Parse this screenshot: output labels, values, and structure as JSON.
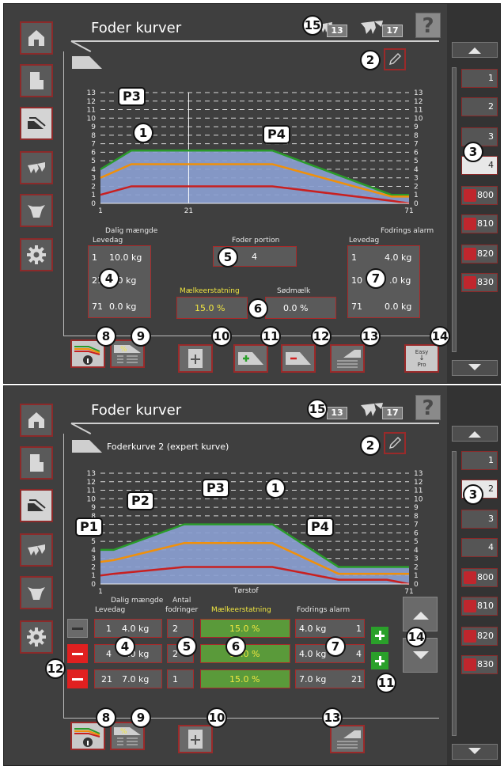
{
  "panel1": {
    "title": "Foder kurver",
    "cow_count_1": "13",
    "cow_count_2": "17",
    "help_label": "?",
    "curve_name": "",
    "chart_data": {
      "type": "area",
      "x_ticks": [
        "1",
        "21",
        "71"
      ],
      "y_ticks": [
        "0",
        "1",
        "2",
        "3",
        "4",
        "5",
        "6",
        "7",
        "8",
        "9",
        "10",
        "11",
        "12",
        "13"
      ],
      "x": [
        1,
        8,
        21,
        40,
        67,
        71
      ],
      "series": [
        {
          "color": "#2a9a2a",
          "values": [
            4,
            6.2,
            6.2,
            6.2,
            1.0,
            1.0
          ]
        },
        {
          "color": "#f0900a",
          "values": [
            3,
            4.6,
            4.6,
            4.6,
            0.8,
            0.8
          ]
        },
        {
          "color": "#c82020",
          "values": [
            1,
            2.0,
            2.0,
            2.0,
            0.3,
            0.0
          ]
        }
      ],
      "fill_color": "#8a9ed0",
      "ylim": [
        0,
        13
      ]
    },
    "labels": {
      "dalig_maengde": "Dalig mængde",
      "levedag": "Levedag",
      "foder_portion": "Foder portion",
      "fodrings_alarm": "Fodrings alarm",
      "levedag2": "Levedag",
      "maelkeerstatning": "Mælkeerstatning",
      "sodmaelk": "Sødmælk"
    },
    "daily_rows": [
      {
        "day": "1",
        "amount": "10.0 kg"
      },
      {
        "day": "21",
        "amount": "0.0 kg"
      },
      {
        "day": "71",
        "amount": "0.0 kg"
      }
    ],
    "portion_value": "4",
    "alarm_rows": [
      {
        "day": "1",
        "amount": "4.0 kg"
      },
      {
        "day": "10",
        "amount": ".0 kg"
      },
      {
        "day": "71",
        "amount": "0.0 kg"
      }
    ],
    "maelk_value": "15.0 %",
    "sod_value": "0.0 %",
    "easy_label": "Easy",
    "pro_label": "Pro"
  },
  "panel2": {
    "title": "Foder kurver",
    "cow_count_1": "13",
    "cow_count_2": "17",
    "help_label": "?",
    "curve_name": "Foderkurve 2 (expert kurve)",
    "chart_data": {
      "type": "area",
      "x_ticks": [
        "1",
        "71"
      ],
      "y_ticks": [
        "0",
        "1",
        "2",
        "3",
        "4",
        "5",
        "6",
        "7",
        "8",
        "9",
        "10",
        "11",
        "12",
        "13"
      ],
      "x": [
        1,
        4,
        20,
        40,
        55,
        66,
        71
      ],
      "series": [
        {
          "color": "#2a9a2a",
          "values": [
            4,
            4,
            7,
            7,
            2,
            2,
            2
          ]
        },
        {
          "color": "#f0900a",
          "values": [
            2.6,
            2.8,
            4.8,
            4.8,
            1.2,
            1.2,
            1.2
          ]
        },
        {
          "color": "#c82020",
          "values": [
            1,
            1.2,
            2.0,
            2.0,
            0.5,
            0.5,
            0.0
          ]
        }
      ],
      "fill_color": "#8a9ed0",
      "ylim": [
        0,
        13
      ]
    },
    "labels": {
      "dalig_maengde": "Dalig mængde",
      "levedag": "Levedag",
      "antal": "Antal",
      "fodringer": "fodringer",
      "torstof": "Tørstof",
      "maelkeerstatning": "Mælkeerstatning",
      "fodrings_alarm": "Fodrings alarm"
    },
    "rows": [
      {
        "day": "1",
        "amount": "4.0 kg",
        "feedings": "2",
        "pct": "15.0 %",
        "alarm": "4.0 kg",
        "alarm_day": "1"
      },
      {
        "day": "4",
        "amount": "4.0 kg",
        "feedings": "2",
        "pct": "15.0 %",
        "alarm": "4.0 kg",
        "alarm_day": "4"
      },
      {
        "day": "21",
        "amount": "7.0 kg",
        "feedings": "1",
        "pct": "15.0 %",
        "alarm": "7.0 kg",
        "alarm_day": "21"
      }
    ]
  },
  "right_list_1": [
    "1",
    "2",
    "3",
    "4",
    "800",
    "810",
    "820",
    "830"
  ],
  "right_list_2": [
    "1",
    "2",
    "3",
    "4",
    "800",
    "810",
    "820",
    "830"
  ],
  "callouts": {
    "c1": "1",
    "c2": "2",
    "c3": "3",
    "c4": "4",
    "c5": "5",
    "c6": "6",
    "c7": "7",
    "c8": "8",
    "c9": "9",
    "c10": "10",
    "c11": "11",
    "c12": "12",
    "c13": "13",
    "c14": "14",
    "c15": "15",
    "p1": "P1",
    "p2": "P2",
    "p3": "P3",
    "p4": "P4"
  },
  "colors": {
    "background": "#3f3f3f",
    "accent_border": "#a82a2a",
    "highlight_text": "#f0e640"
  },
  "icons": {
    "home": "home-icon",
    "robot": "feeder-icon",
    "curves": "feed-curves-icon",
    "calves": "calves-icon",
    "cow": "cow-head-icon",
    "settings": "gear-icon",
    "pencil": "pencil-icon",
    "help": "help-icon"
  }
}
